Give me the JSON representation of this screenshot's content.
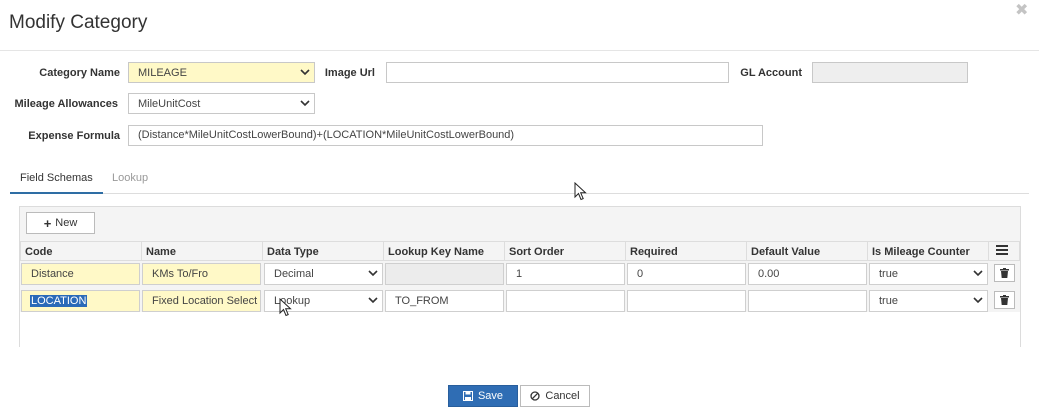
{
  "dialog": {
    "title": "Modify Category"
  },
  "form": {
    "category_name_label": "Category Name",
    "category_name_value": "MILEAGE",
    "image_url_label": "Image Url",
    "image_url_value": "",
    "gl_account_label": "GL Account",
    "gl_account_value": "",
    "mileage_allowances_label": "Mileage Allowances",
    "mileage_allowances_value": "MileUnitCost",
    "expense_formula_label": "Expense Formula",
    "expense_formula_value": "(Distance*MileUnitCostLowerBound)+(LOCATION*MileUnitCostLowerBound)"
  },
  "tabs": [
    {
      "label": "Field Schemas",
      "active": true
    },
    {
      "label": "Lookup",
      "active": false
    }
  ],
  "grid": {
    "new_label": "New",
    "columns": [
      "Code",
      "Name",
      "Data Type",
      "Lookup Key Name",
      "Sort Order",
      "Required",
      "Default Value",
      "Is Mileage Counter"
    ],
    "rows": [
      {
        "code": "Distance",
        "name": "KMs To/Fro",
        "data_type": "Decimal",
        "lookup_key": "",
        "sort_order": "1",
        "required": "0",
        "default_value": "0.00",
        "mileage_counter": "true"
      },
      {
        "code": "LOCATION",
        "name": "Fixed Location Select",
        "data_type": "Lookup",
        "lookup_key": "TO_FROM",
        "sort_order": "",
        "required": "",
        "default_value": "",
        "mileage_counter": "true"
      }
    ]
  },
  "footer": {
    "save_label": "Save",
    "cancel_label": "Cancel"
  },
  "colors": {
    "accent": "#2f6db4",
    "required_field": "#fff9c7"
  }
}
